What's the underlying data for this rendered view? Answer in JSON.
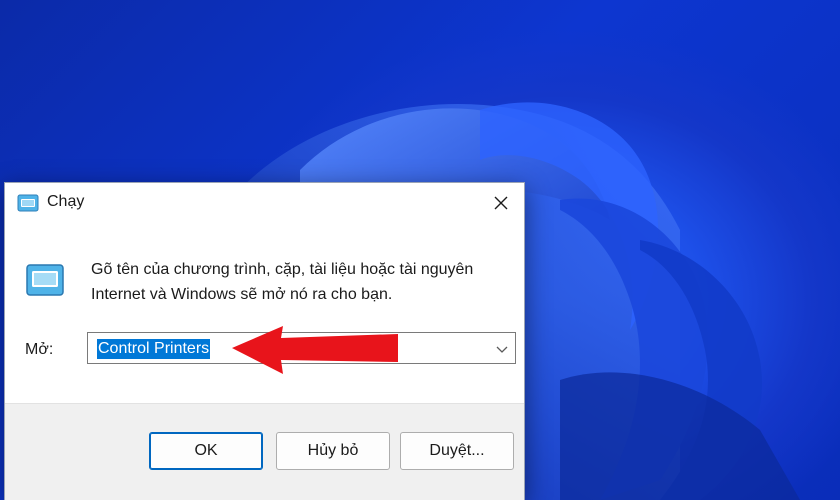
{
  "dialog": {
    "title": "Chạy",
    "title_icon": "run-app-icon",
    "close_icon": "close-icon",
    "description": "Gõ tên của chương trình, cặp, tài liệu hoặc tài nguyên Internet và Windows sẽ mở nó ra cho bạn.",
    "open_label": "Mở:",
    "open_value": "Control Printers",
    "buttons": {
      "ok": "OK",
      "cancel": "Hủy bỏ",
      "browse": "Duyệt..."
    }
  },
  "colors": {
    "selection": "#0078d7",
    "annotation_arrow": "#e8141b",
    "wallpaper": "#1d4fe8"
  }
}
